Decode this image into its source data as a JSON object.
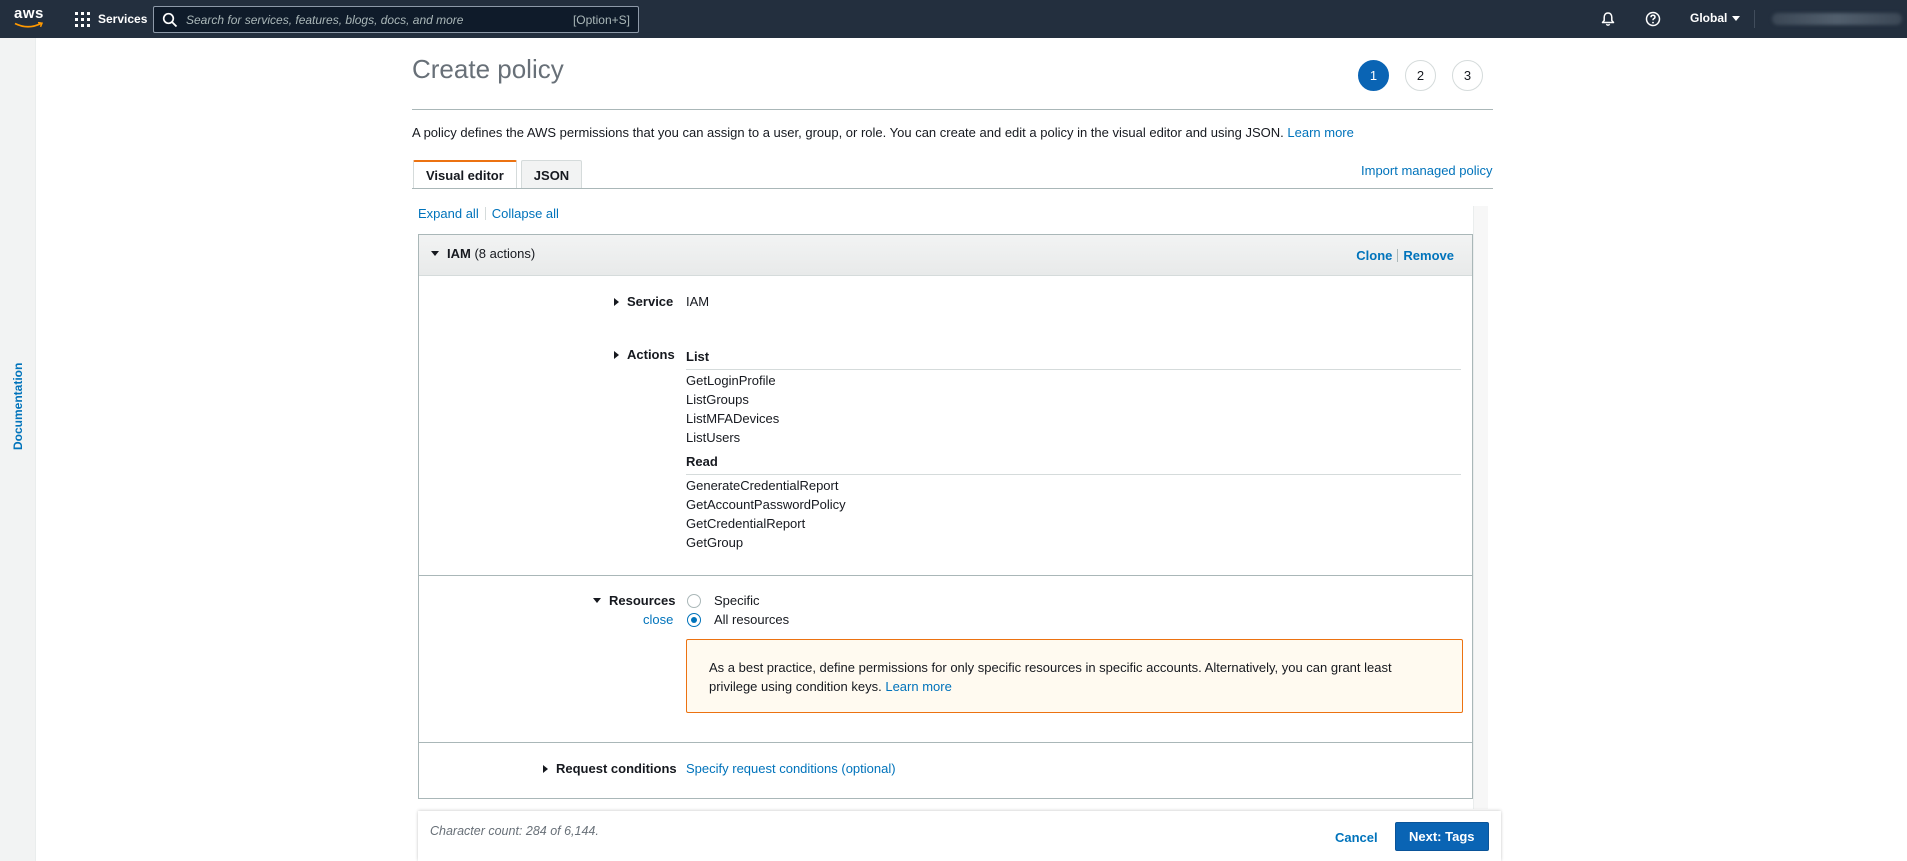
{
  "topnav": {
    "logo_text": "aws",
    "services_label": "Services",
    "search_placeholder": "Search for services, features, blogs, docs, and more",
    "search_shortcut": "[Option+S]",
    "region_label": "Global"
  },
  "sidebar": {
    "documentation_label": "Documentation"
  },
  "header": {
    "title": "Create policy",
    "steps": [
      "1",
      "2",
      "3"
    ],
    "active_step": "1",
    "intro_text": "A policy defines the AWS permissions that you can assign to a user, group, or role. You can create and edit a policy in the visual editor and using JSON.",
    "intro_link": "Learn more"
  },
  "tabs": {
    "visual_editor": "Visual editor",
    "json": "JSON",
    "import_link": "Import managed policy"
  },
  "controls": {
    "expand_all": "Expand all",
    "collapse_all": "Collapse all"
  },
  "policy_block": {
    "service_title": "IAM",
    "action_count": "(8 actions)",
    "clone_label": "Clone",
    "remove_label": "Remove",
    "service_label": "Service",
    "service_value": "IAM",
    "actions_label": "Actions",
    "action_groups": [
      {
        "name": "List",
        "actions": [
          "GetLoginProfile",
          "ListGroups",
          "ListMFADevices",
          "ListUsers"
        ]
      },
      {
        "name": "Read",
        "actions": [
          "GenerateCredentialReport",
          "GetAccountPasswordPolicy",
          "GetCredentialReport",
          "GetGroup"
        ]
      }
    ],
    "resources_label": "Resources",
    "resources_close": "close",
    "resource_options": [
      "Specific",
      "All resources"
    ],
    "selected_resource": "All resources",
    "warning_text": "As a best practice, define permissions for only specific resources in specific accounts. Alternatively, you can grant least privilege using condition keys.",
    "warning_link": "Learn more",
    "request_conditions_label": "Request conditions",
    "request_conditions_link": "Specify request conditions (optional)"
  },
  "footer": {
    "char_count": "Character count: 284 of 6,144.",
    "cancel_label": "Cancel",
    "next_label": "Next: Tags"
  },
  "colors": {
    "nav_bg": "#232f3e",
    "link": "#0073bb",
    "primary": "#0a64b4",
    "tab_accent": "#ec7211",
    "warning_bg": "#fffaf0"
  }
}
